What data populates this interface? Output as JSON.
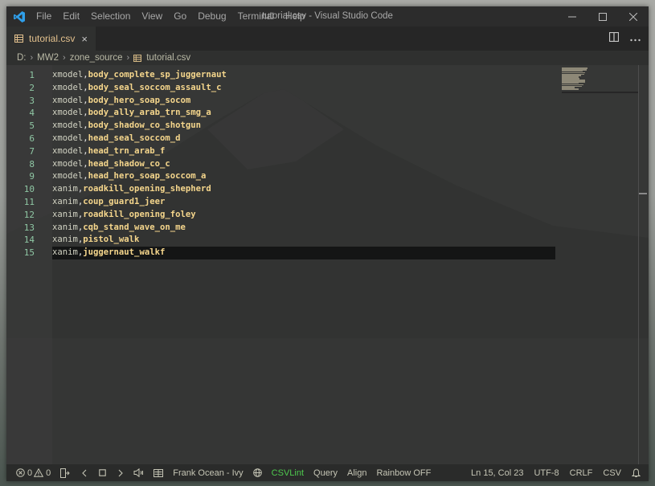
{
  "window": {
    "title": "tutorial.csv - Visual Studio Code",
    "app_icon": "vscode-logo-icon",
    "controls": [
      "minimize-icon",
      "maximize-icon",
      "close-icon"
    ]
  },
  "menu": [
    "File",
    "Edit",
    "Selection",
    "View",
    "Go",
    "Debug",
    "Terminal",
    "Help"
  ],
  "tabs": [
    {
      "label": "tutorial.csv",
      "icon": "table-file-icon",
      "active": true,
      "close": "×"
    }
  ],
  "tab_actions": [
    "split-editor-icon",
    "more-actions-icon"
  ],
  "breadcrumb": [
    "D:",
    "MW2",
    "zone_source",
    "tutorial.csv"
  ],
  "editor": {
    "current_line": 15,
    "lines": [
      {
        "n": "1",
        "type": "xmodel",
        "value": "body_complete_sp_juggernaut"
      },
      {
        "n": "2",
        "type": "xmodel",
        "value": "body_seal_soccom_assault_c"
      },
      {
        "n": "3",
        "type": "xmodel",
        "value": "body_hero_soap_socom"
      },
      {
        "n": "4",
        "type": "xmodel",
        "value": "body_ally_arab_trn_smg_a"
      },
      {
        "n": "5",
        "type": "xmodel",
        "value": "body_shadow_co_shotgun"
      },
      {
        "n": "6",
        "type": "xmodel",
        "value": "head_seal_soccom_d"
      },
      {
        "n": "7",
        "type": "xmodel",
        "value": "head_trn_arab_f"
      },
      {
        "n": "8",
        "type": "xmodel",
        "value": "head_shadow_co_c"
      },
      {
        "n": "9",
        "type": "xmodel",
        "value": "head_hero_soap_soccom_a"
      },
      {
        "n": "10",
        "type": "xanim",
        "value": "roadkill_opening_shepherd"
      },
      {
        "n": "11",
        "type": "xanim",
        "value": "coup_guard1_jeer"
      },
      {
        "n": "12",
        "type": "xanim",
        "value": "roadkill_opening_foley"
      },
      {
        "n": "13",
        "type": "xanim",
        "value": "cqb_stand_wave_on_me"
      },
      {
        "n": "14",
        "type": "xanim",
        "value": "pistol_walk"
      },
      {
        "n": "15",
        "type": "xanim",
        "value": "juggernaut_walkf"
      }
    ],
    "separator": ","
  },
  "statusbar": {
    "errors": "0",
    "warnings": "0",
    "media_track": "Frank Ocean - Ivy",
    "csvlint": "CSVLint",
    "query": "Query",
    "align": "Align",
    "rainbow": "Rainbow OFF",
    "position": "Ln 15, Col 23",
    "encoding": "UTF-8",
    "eol": "CRLF",
    "language": "CSV",
    "accent_green": "#4ec94e"
  }
}
